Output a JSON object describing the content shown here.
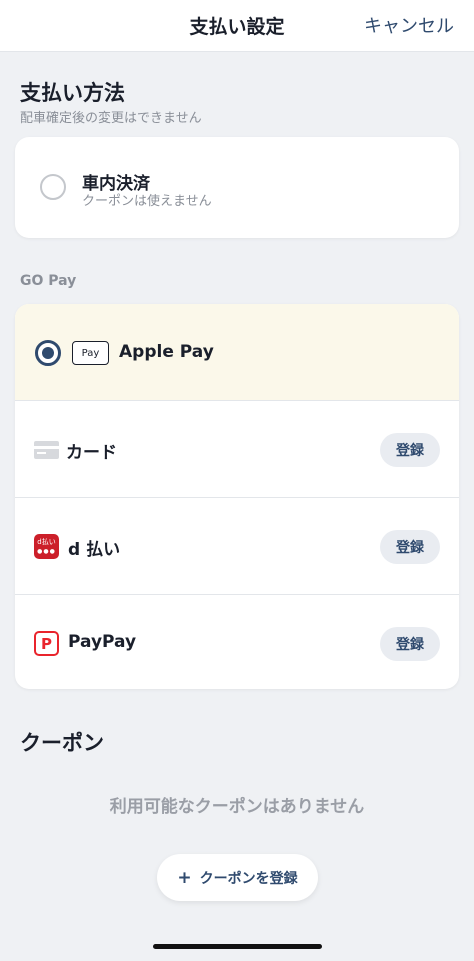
{
  "header": {
    "title": "支払い設定",
    "cancel_label": "キャンセル"
  },
  "payment_method": {
    "title": "支払い方法",
    "subtitle": "配車確定後の変更はできません",
    "in_car": {
      "label": "車内決済",
      "note": "クーポンは使えません",
      "selected": false
    }
  },
  "go_pay": {
    "label": "GO Pay",
    "options": [
      {
        "label": "Apple Pay",
        "icon": "apple-pay-icon",
        "icon_text": "Pay",
        "selected": true
      },
      {
        "label": "カード",
        "icon": "credit-card-icon",
        "register_label": "登録"
      },
      {
        "label": "d 払い",
        "icon": "d-barai-icon",
        "icon_text": "d払い",
        "register_label": "登録"
      },
      {
        "label": "PayPay",
        "icon": "paypay-icon",
        "icon_text": "P",
        "register_label": "登録"
      }
    ]
  },
  "coupon": {
    "title": "クーポン",
    "empty_text": "利用可能なクーポンはありません",
    "register_label": "クーポンを登録",
    "plus_symbol": "+"
  },
  "colors": {
    "accent": "#2f4a6e",
    "selected_row": "#fbf8ea",
    "background": "#eff1f4"
  }
}
